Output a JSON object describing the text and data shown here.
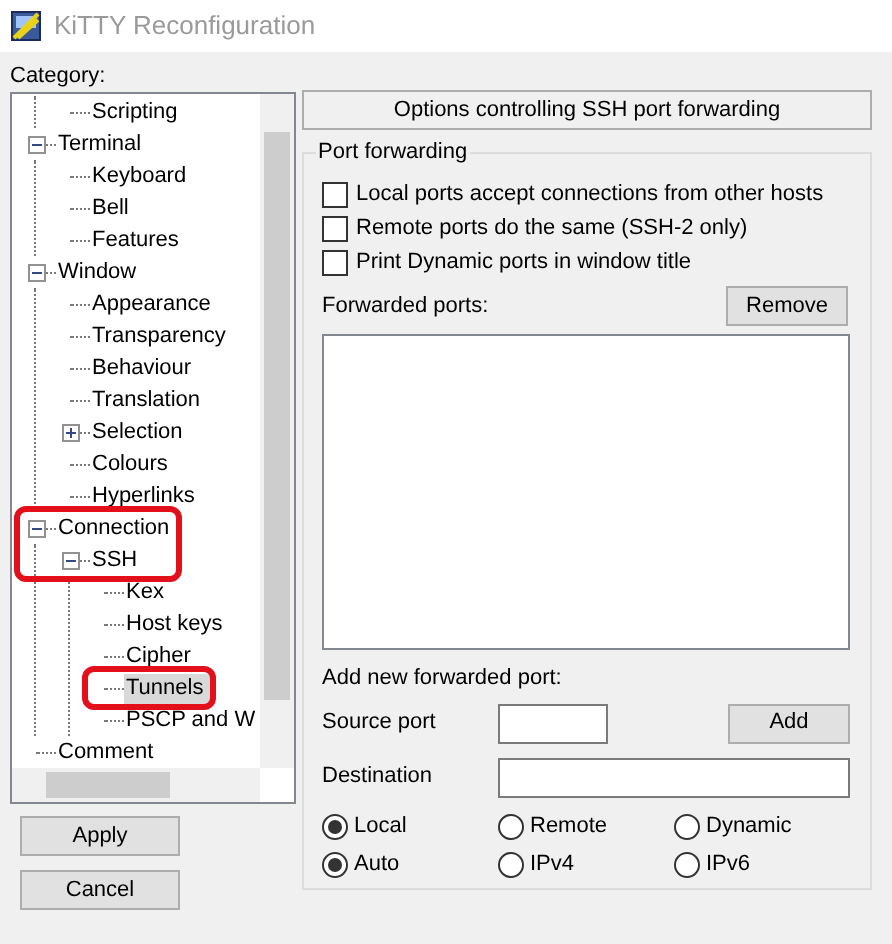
{
  "window": {
    "title": "KiTTY Reconfiguration"
  },
  "category_label": "Category:",
  "tree": [
    {
      "children": [
        {
          "label": "Scripting",
          "selected": false,
          "circled": false
        }
      ]
    },
    {
      "label": "Terminal",
      "expanded": true,
      "selected": false,
      "circled": false,
      "children": [
        {
          "label": "Keyboard",
          "selected": false,
          "circled": false
        },
        {
          "label": "Bell",
          "selected": false,
          "circled": false
        },
        {
          "label": "Features",
          "selected": false,
          "circled": false
        }
      ]
    },
    {
      "label": "Window",
      "expanded": true,
      "selected": false,
      "circled": false,
      "children": [
        {
          "label": "Appearance",
          "selected": false,
          "circled": false
        },
        {
          "label": "Transparency",
          "selected": false,
          "circled": false
        },
        {
          "label": "Behaviour",
          "selected": false,
          "circled": false
        },
        {
          "label": "Translation",
          "selected": false,
          "circled": false
        },
        {
          "label": "Selection",
          "expanded": false,
          "selected": false,
          "circled": false
        },
        {
          "label": "Colours",
          "selected": false,
          "circled": false
        },
        {
          "label": "Hyperlinks",
          "selected": false,
          "circled": false
        }
      ]
    },
    {
      "label": "Connection",
      "expanded": true,
      "selected": false,
      "circled": true,
      "children": [
        {
          "label": "SSH",
          "expanded": true,
          "selected": false,
          "circled": true,
          "children": [
            {
              "label": "Kex",
              "selected": false,
              "circled": false
            },
            {
              "label": "Host keys",
              "selected": false,
              "circled": false
            },
            {
              "label": "Cipher",
              "selected": false,
              "circled": false
            },
            {
              "label": "Tunnels",
              "selected": true,
              "circled": true
            },
            {
              "label": "PSCP and W",
              "selected": false,
              "circled": false
            }
          ]
        }
      ]
    },
    {
      "label": "Comment",
      "selected": false,
      "circled": false
    }
  ],
  "buttons": [
    {
      "label": "Apply"
    },
    {
      "label": "Cancel"
    }
  ],
  "panel": {
    "header": "Options controlling SSH port forwarding",
    "group_title": "Port forwarding",
    "checkboxes": [
      {
        "label": "Local ports accept connections from other hosts",
        "checked": false
      },
      {
        "label": "Remote ports do the same (SSH-2 only)",
        "checked": false
      },
      {
        "label": "Print Dynamic ports in window title",
        "checked": false
      }
    ],
    "forwarded_ports_label": "Forwarded ports:",
    "remove_button": "Remove",
    "add_label": "Add new forwarded port:",
    "source_port_label": "Source port",
    "add_button": "Add",
    "destination_label": "Destination",
    "radio_rows": [
      [
        {
          "label": "Local",
          "selected": true
        },
        {
          "label": "Remote",
          "selected": false
        },
        {
          "label": "Dynamic",
          "selected": false
        }
      ],
      [
        {
          "label": "Auto",
          "selected": true
        },
        {
          "label": "IPv4",
          "selected": false
        },
        {
          "label": "IPv6",
          "selected": false
        }
      ]
    ]
  }
}
